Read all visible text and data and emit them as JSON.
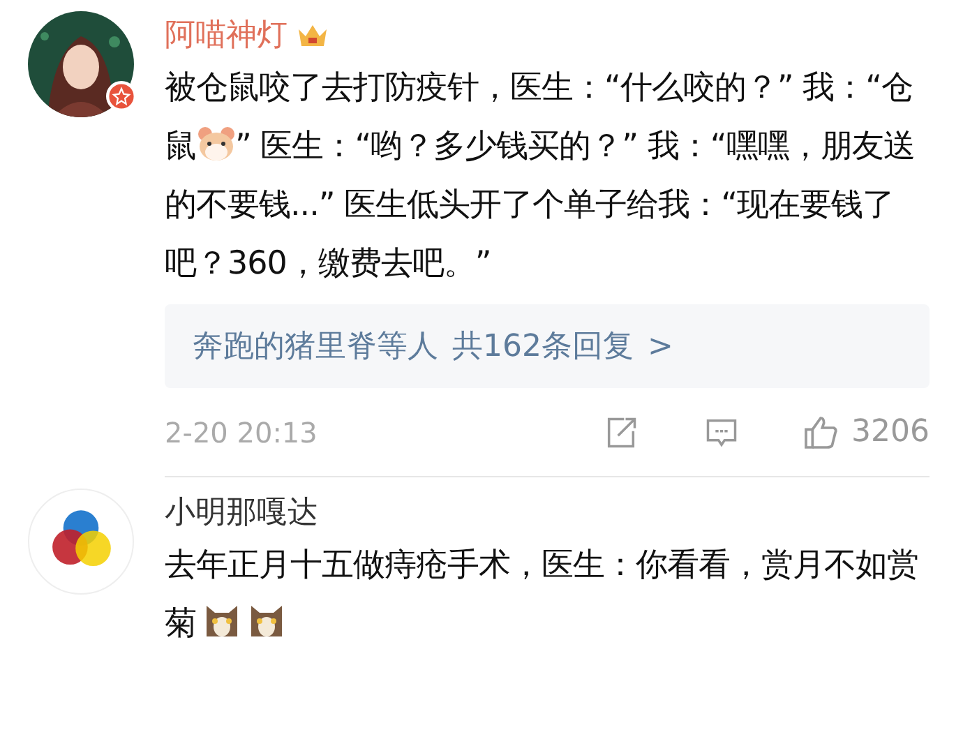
{
  "comments": [
    {
      "author": "阿喵神灯",
      "crown": true,
      "verified": true,
      "parts": [
        {
          "kind": "text",
          "text": "被仓鼠咬了去打防疫针，医生：“什么咬的？” 我：“仓鼠"
        },
        {
          "kind": "hamster"
        },
        {
          "kind": "text",
          "text": "” 医生：“哟？多少钱买的？” 我：“嘿嘿，朋友送的不要钱...” 医生低头开了个单子给我：“现在要钱了吧？360，缴费去吧。”"
        }
      ],
      "replies": {
        "names": "奔跑的猪里脊等人",
        "count": "共162条回复",
        "arrow": ">"
      },
      "time": "2-20 20:13",
      "likes": "3206"
    },
    {
      "author": "小明那嘎达",
      "avatar": {
        "kind": "circles"
      },
      "crown": false,
      "verified": false,
      "parts": [
        {
          "kind": "text",
          "text": "去年正月十五做痔疮手术，医生：你看看，赏月不如赏菊"
        },
        {
          "kind": "cat"
        },
        {
          "kind": "cat"
        }
      ]
    }
  ]
}
